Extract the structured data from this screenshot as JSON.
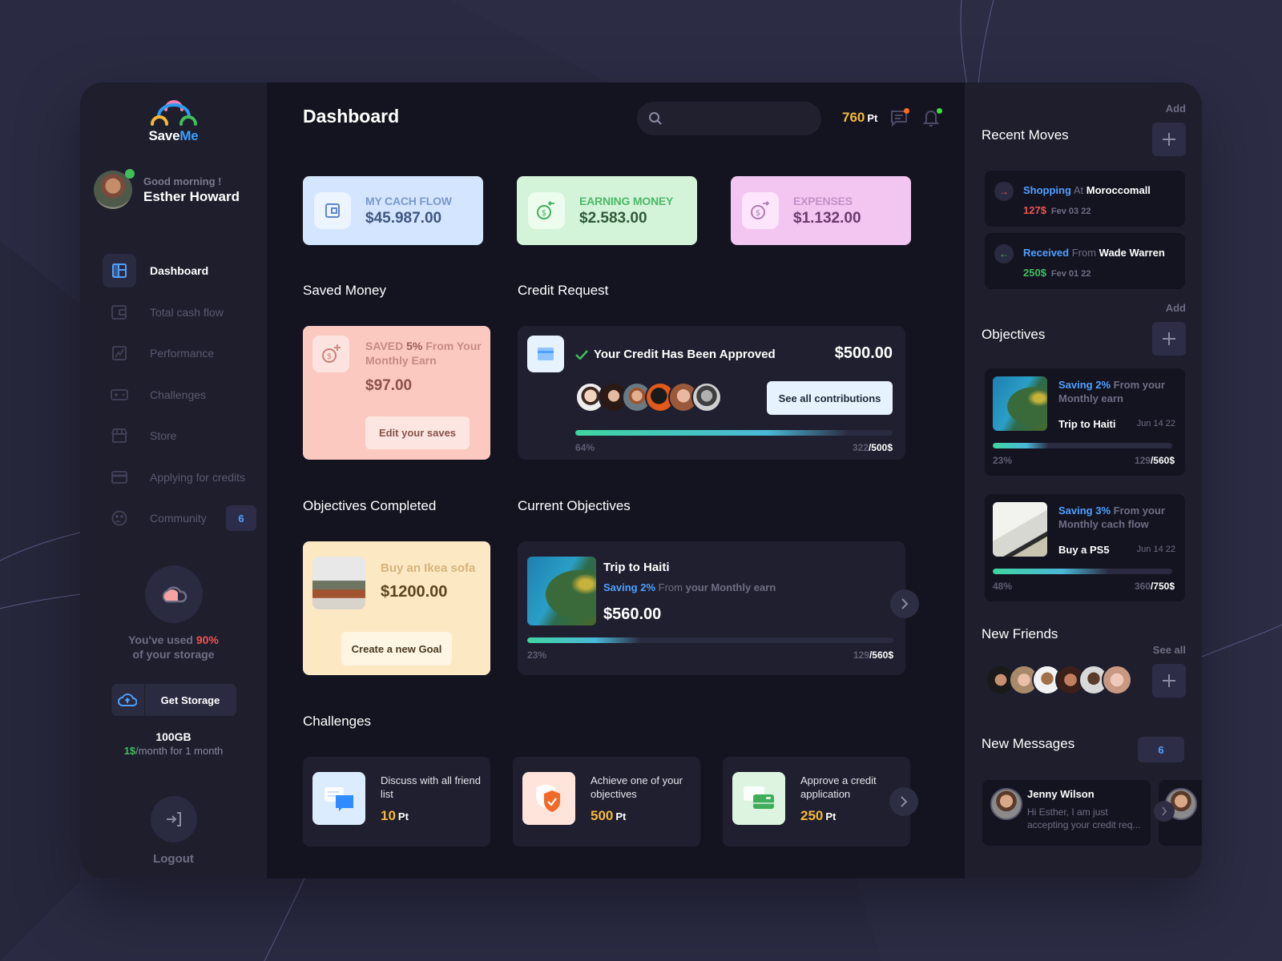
{
  "app": {
    "logo_part1": "Save",
    "logo_part2": "Me",
    "accent": "#3a9fff"
  },
  "user": {
    "greeting": "Good morning !",
    "name": "Esther Howard",
    "status": "online"
  },
  "sidebar": {
    "items": [
      {
        "label": "Dashboard",
        "icon": "dashboard-icon",
        "active": true
      },
      {
        "label": "Total cash flow",
        "icon": "wallet-icon"
      },
      {
        "label": "Performance",
        "icon": "chart-icon"
      },
      {
        "label": "Challenges",
        "icon": "gamepad-icon"
      },
      {
        "label": "Store",
        "icon": "store-icon"
      },
      {
        "label": "Applying for credits",
        "icon": "credit-card-icon"
      },
      {
        "label": "Community",
        "icon": "community-icon",
        "badge": "6"
      }
    ],
    "storage": {
      "text_before": "You've used ",
      "percent": "90%",
      "text_after": "of your storage",
      "button": "Get Storage",
      "plan_size": "100GB",
      "plan_price": "1$",
      "plan_period": "/month for 1 month"
    },
    "logout": "Logout"
  },
  "header": {
    "title": "Dashboard",
    "search_placeholder": "",
    "points": "760",
    "points_unit": "Pt"
  },
  "stats": [
    {
      "label": "MY CACH FLOW",
      "value": "$45.987.00",
      "icon": "wallet-icon"
    },
    {
      "label": "EARNING MONEY",
      "value": "$2.583.00",
      "icon": "money-in-icon"
    },
    {
      "label": "EXPENSES",
      "value": "$1.132.00",
      "icon": "money-out-icon"
    }
  ],
  "saved_money": {
    "title": "Saved Money",
    "prefix": "SAVED ",
    "percent": "5%",
    "suffix": " From Your Monthly Earn",
    "amount": "$97.00",
    "button": "Edit your saves"
  },
  "credit_request": {
    "title": "Credit Request",
    "status": "Your Credit Has Been Approved",
    "amount": "$500.00",
    "button": "See all contributions",
    "contributors": 6,
    "progress_pct": 64,
    "progress_label": "64%",
    "current": "322",
    "target": "/500$"
  },
  "objectives_completed": {
    "title": "Objectives Completed",
    "name": "Buy an Ikea sofa",
    "amount": "$1200.00",
    "button": "Create a new Goal"
  },
  "current_objectives": {
    "title": "Current Objectives",
    "name": "Trip to Haiti",
    "saving": "Saving 2%",
    "from": " From ",
    "source": "your Monthly earn",
    "amount": "$560.00",
    "progress_pct": 23,
    "progress_label": "23%",
    "current": "129",
    "target": "/560$"
  },
  "challenges": {
    "title": "Challenges",
    "items": [
      {
        "text": "Discuss with all friend list",
        "points": "10",
        "unit": "Pt",
        "icon": "chat-icon"
      },
      {
        "text": "Achieve one of your objectives",
        "points": "500",
        "unit": "Pt",
        "icon": "shield-check-icon"
      },
      {
        "text": "Approve a credit application",
        "points": "250",
        "unit": "Pt",
        "icon": "credit-card-icon"
      }
    ]
  },
  "recent_moves": {
    "title": "Recent Moves",
    "add_label": "Add",
    "items": [
      {
        "type": "Shopping",
        "prep": " At ",
        "party": "Moroccomall",
        "amount": "127$",
        "date": "Fev 03 22",
        "direction": "out"
      },
      {
        "type": "Received",
        "prep": " From ",
        "party": "Wade Warren",
        "amount": "250$",
        "date": "Fev 01 22",
        "direction": "in"
      }
    ]
  },
  "objectives": {
    "title": "Objectives",
    "add_label": "Add",
    "items": [
      {
        "saving": "Saving 2%",
        "desc": " From your Monthly earn",
        "name": "Trip to Haiti",
        "date": "Jun 14 22",
        "progress_pct": 23,
        "progress_label": "23%",
        "current": "129",
        "target": "/560$"
      },
      {
        "saving": "Saving 3%",
        "desc": " From your Monthly cach flow",
        "name": "Buy a PS5",
        "date": "Jun 14 22",
        "progress_pct": 48,
        "progress_label": "48%",
        "current": "360",
        "target": "/750$"
      }
    ]
  },
  "new_friends": {
    "title": "New Friends",
    "see_all": "See all",
    "count": 6
  },
  "new_messages": {
    "title": "New Messages",
    "badge": "6",
    "items": [
      {
        "name": "Jenny Wilson",
        "text": "Hi Esther, I am just accepting your credit req..."
      }
    ]
  }
}
